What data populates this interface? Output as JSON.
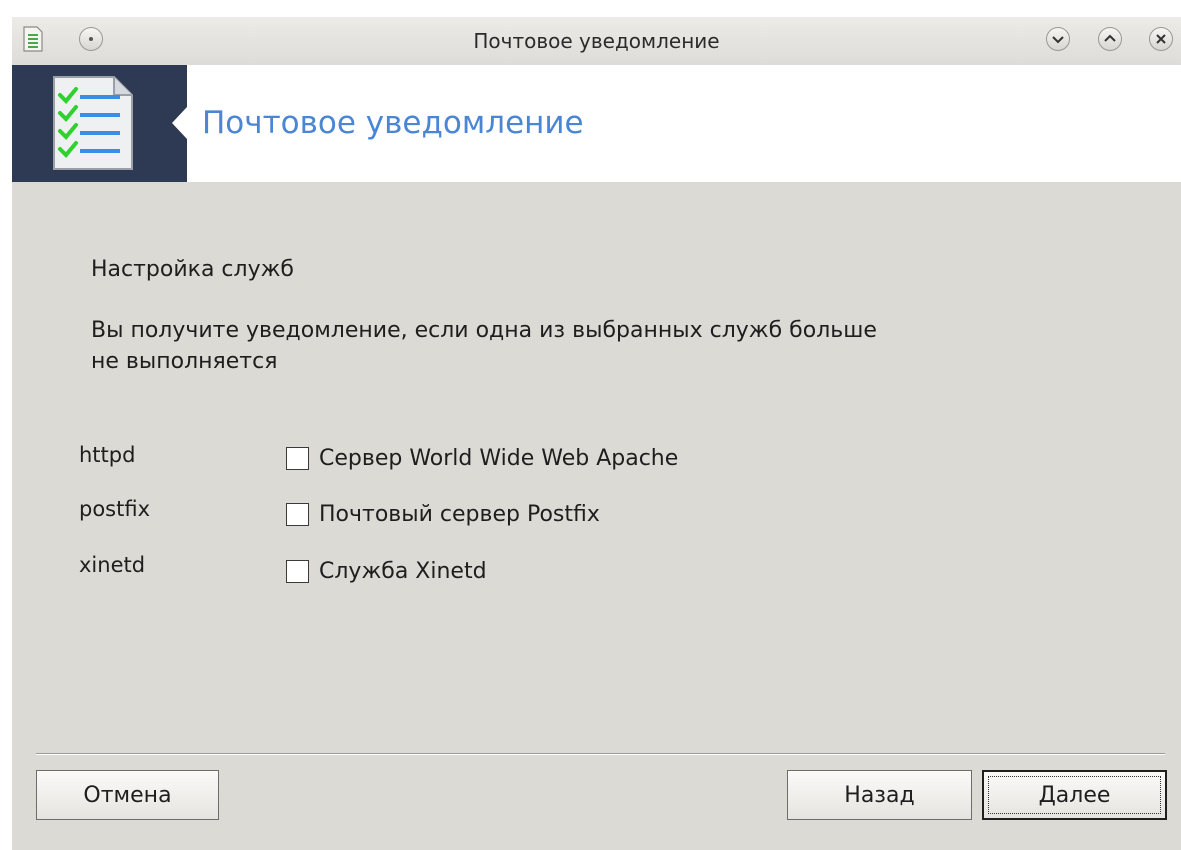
{
  "window": {
    "title": "Почтовое уведомление"
  },
  "header": {
    "title": "Почтовое уведомление",
    "icon": "checklist-document-icon"
  },
  "content": {
    "section_title": "Настройка служб",
    "description_line1": "Вы получите уведомление, если одна из выбранных служб больше",
    "description_line2": "не выполняется",
    "services": [
      {
        "name": "httpd",
        "label": "Сервер World Wide Web Apache",
        "checked": false
      },
      {
        "name": "postfix",
        "label": "Почтовый сервер Postfix",
        "checked": false
      },
      {
        "name": "xinetd",
        "label": "Служба Xinetd",
        "checked": false
      }
    ]
  },
  "buttons": {
    "cancel": "Отмена",
    "back": "Назад",
    "next": "Далее"
  },
  "colors": {
    "header_accent": "#4a86d4",
    "banner_dark": "#2e3a53",
    "background": "#dcdad5"
  }
}
